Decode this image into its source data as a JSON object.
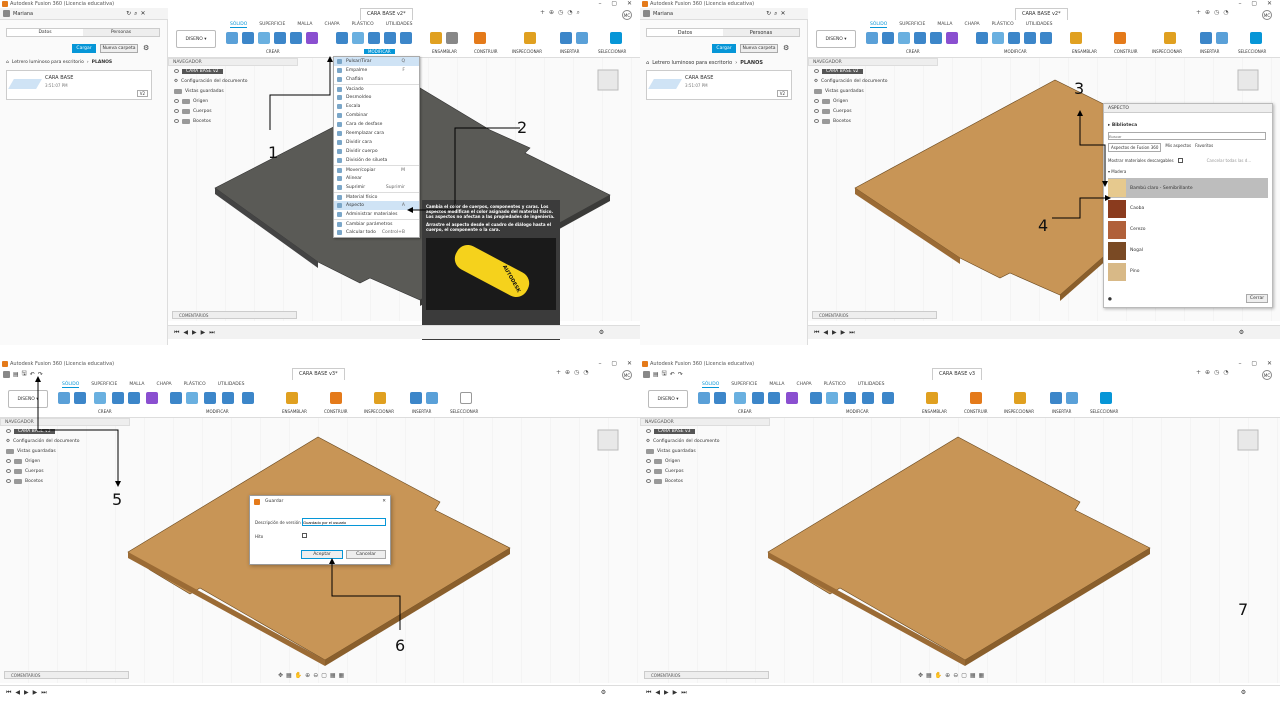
{
  "app_title": "Autodesk Fusion 360 (Licencia educativa)",
  "user": "Mariana",
  "user_initials": "MC",
  "doc_tabs": [
    "CARA BASE v2*",
    "CARA BASE v2*",
    "CARA BASE v3*",
    "CARA BASE v3"
  ],
  "ribbon_tabs": [
    "SÓLIDO",
    "SUPERFICIE",
    "MALLA",
    "CHAPA",
    "PLÁSTICO",
    "UTILIDADES"
  ],
  "design_button": "DISEÑO",
  "groups": [
    "CREAR",
    "MODIFICAR",
    "ENSAMBLAR",
    "CONSTRUIR",
    "INSPECCIONAR",
    "INSERTAR",
    "SELECCIONAR"
  ],
  "data_panel": {
    "tabs": [
      "Datos",
      "Personas"
    ],
    "upload": "Cargar",
    "new_folder": "Nueva carpeta",
    "breadcrumb": [
      "Letrero luminoso para escritorio",
      "PLANOS"
    ],
    "file_name": "CARA BASE",
    "file_time": "3:51:07 PM",
    "file_version": "V2"
  },
  "navigator": {
    "title": "NAVEGADOR",
    "root": [
      "CARA BASE v2",
      "CARA BASE v2",
      "CARA BASE v3",
      "CARA BASE v3"
    ],
    "items": [
      "Configuración del documento",
      "Vistas guardadas",
      "Origen",
      "Cuerpos",
      "Bocetos"
    ]
  },
  "comments": "COMENTARIOS",
  "modify_menu": {
    "header": "MODIFICAR",
    "items": [
      {
        "label": "Pulsar/Tirar",
        "key": "Q"
      },
      {
        "label": "Empalme",
        "key": "F"
      },
      {
        "label": "Chaflán",
        "key": ""
      },
      {
        "label": "Vaciado",
        "key": ""
      },
      {
        "label": "Desmoldeo",
        "key": ""
      },
      {
        "label": "Escala",
        "key": ""
      },
      {
        "label": "Combinar",
        "key": ""
      },
      {
        "label": "Cara de desfase",
        "key": ""
      },
      {
        "label": "Reemplazar cara",
        "key": ""
      },
      {
        "label": "Dividir cara",
        "key": ""
      },
      {
        "label": "Dividir cuerpo",
        "key": ""
      },
      {
        "label": "División de silueta",
        "key": ""
      },
      {
        "label": "Mover/copiar",
        "key": "M"
      },
      {
        "label": "Alinear",
        "key": ""
      },
      {
        "label": "Suprimir",
        "key": "Suprimir"
      },
      {
        "label": "Material físico",
        "key": ""
      },
      {
        "label": "Aspecto",
        "key": "A"
      },
      {
        "label": "Administrar materiales",
        "key": ""
      },
      {
        "label": "Cambiar parámetros",
        "key": ""
      },
      {
        "label": "Calcular todo",
        "key": "Control+B"
      }
    ]
  },
  "tooltip": {
    "text": "Cambia el color de cuerpos, componentes y caras. Los aspectos modifican el color asignado del material físico. Los aspectos no afectan a las propiedades de ingeniería.",
    "text2": "Arrastre el aspecto desde el cuadro de diálogo hasta el cuerpo, el componente o la cara.",
    "footer": "Pulse Ctrl+/ para obtener más ayuda.",
    "brand": "AUTODESK"
  },
  "appearance": {
    "title": "ASPECTO",
    "library": "Biblioteca",
    "search_placeholder": "Buscar",
    "tabs": [
      "Aspectos de Fusion 360",
      "Mis aspectos",
      "Favoritos"
    ],
    "show_downloadable": "Mostrar materiales descargables",
    "cancel_all": "Cancelar todas las d...",
    "folder": "Madera",
    "materials": [
      "Bambú claro - Semibrillante",
      "Caoba",
      "Cerezo",
      "Nogal",
      "Pino"
    ],
    "close": "Cerrar"
  },
  "save_dialog": {
    "title": "Guardar",
    "desc_label": "Descripción de versión",
    "desc_value": "Guardado por el usuario",
    "milestone": "Hito",
    "ok": "Aceptar",
    "cancel": "Cancelar"
  },
  "callouts": [
    "1",
    "2",
    "3",
    "4",
    "5",
    "6",
    "7"
  ],
  "colors": {
    "accent": "#0696d7",
    "wood": "#c89556",
    "dark": "#5a5a56",
    "orange": "#e47a1a"
  }
}
